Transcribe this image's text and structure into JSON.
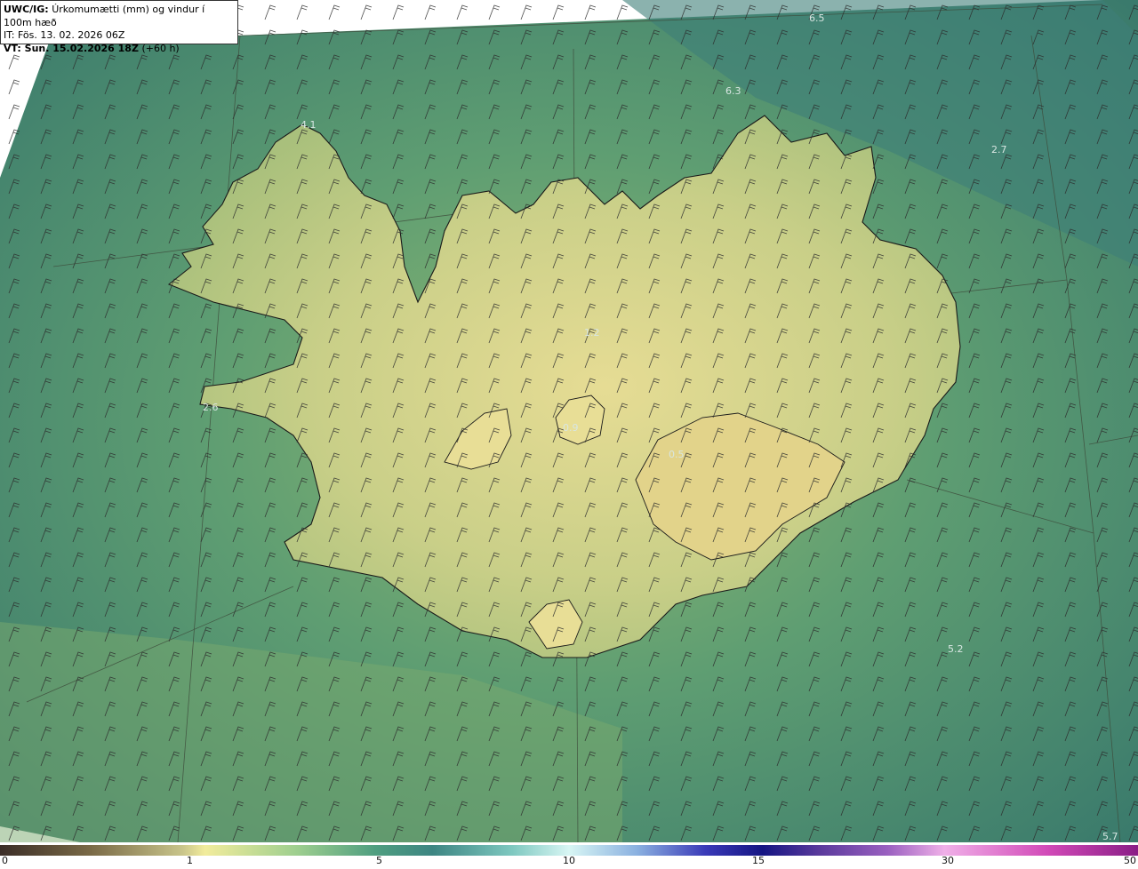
{
  "title": {
    "product": "UWC/IG:",
    "description": "Úrkomumætti (mm) og vindur í 100m hæð",
    "issue_time": "IT: Fös. 13. 02. 2026 06Z",
    "valid_label": "VT: Sun. 15.02.2026 18Z",
    "valid_offset": "(+60 h)"
  },
  "value_labels": [
    "6.5",
    "6.3",
    "4.1",
    "2.7",
    "1.2",
    "2.6",
    "0.9",
    "0.5",
    "5.2",
    "5.7"
  ],
  "colorbar": {
    "ticks": [
      "0",
      "1",
      "5",
      "10",
      "15",
      "30",
      "50"
    ],
    "colors": [
      "#3b2d27",
      "#7a6a47",
      "#c8c48a",
      "#f2ec9c",
      "#9fcf8f",
      "#4f9e80",
      "#3d8582",
      "#7ec8c0",
      "#d8f6f4",
      "#8ab0e0",
      "#3a3ab8",
      "#151583",
      "#5a3a9c",
      "#9a60c0",
      "#f0b0e8",
      "#d24ab8",
      "#8a1e86"
    ]
  },
  "palette": {
    "ocean": "#3a7e6e",
    "land": "#d8d48a",
    "coast": "#1a1a1a"
  }
}
